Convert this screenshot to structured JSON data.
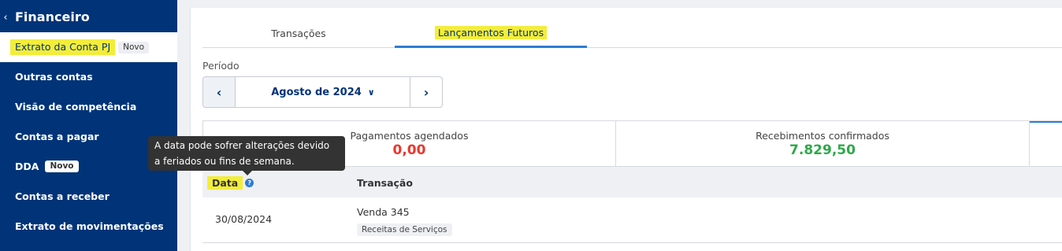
{
  "sidebar": {
    "title": "Financeiro",
    "back_icon": "chevron-left-icon",
    "active_item": {
      "label": "Extrato da Conta PJ",
      "badge": "Novo"
    },
    "items": [
      {
        "label": "Outras contas"
      },
      {
        "label": "Visão de competência"
      },
      {
        "label": "Contas a pagar"
      },
      {
        "label": "DDA",
        "badge": "Novo"
      },
      {
        "label": "Contas a receber"
      },
      {
        "label": "Extrato de movimentações"
      }
    ]
  },
  "tabs": [
    {
      "label": "Transações"
    },
    {
      "label": "Lançamentos Futuros"
    }
  ],
  "period": {
    "label": "Período",
    "value": "Agosto de 2024"
  },
  "summary": {
    "scheduled_payments": {
      "label": "Pagamentos agendados",
      "value": "0,00"
    },
    "confirmed_receipts": {
      "label": "Recebimentos confirmados",
      "value": "7.829,50"
    }
  },
  "table": {
    "headers": {
      "date": "Data",
      "transaction": "Transação"
    },
    "rows": [
      {
        "date": "30/08/2024",
        "description": "Venda 345",
        "category": "Receitas de Serviços"
      }
    ]
  },
  "tooltip": {
    "line1": "A data pode sofrer alterações devido",
    "line2": "a feriados ou fins de semana."
  },
  "colors": {
    "sidebar_bg": "#003378",
    "highlight": "#f3ed3a",
    "accent": "#2d7dd2",
    "negative": "#e8372c",
    "positive": "#2ea84a"
  }
}
